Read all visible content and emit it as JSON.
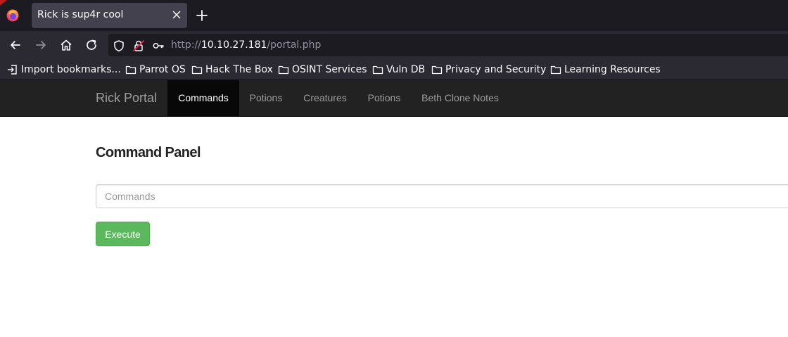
{
  "browser": {
    "tab": {
      "title": "Rick is sup4r cool"
    },
    "url": {
      "scheme": "http://",
      "host": "10.10.27.181",
      "path": "/portal.php"
    },
    "bookmarks": [
      {
        "label": "Import bookmarks...",
        "icon": "import-icon"
      },
      {
        "label": "Parrot OS",
        "icon": "folder-icon"
      },
      {
        "label": "Hack The Box",
        "icon": "folder-icon"
      },
      {
        "label": "OSINT Services",
        "icon": "folder-icon"
      },
      {
        "label": "Vuln DB",
        "icon": "folder-icon"
      },
      {
        "label": "Privacy and Security",
        "icon": "folder-icon"
      },
      {
        "label": "Learning Resources",
        "icon": "folder-icon"
      }
    ]
  },
  "site": {
    "brand": "Rick Portal",
    "menu": [
      {
        "label": "Commands",
        "active": true
      },
      {
        "label": "Potions",
        "active": false
      },
      {
        "label": "Creatures",
        "active": false
      },
      {
        "label": "Potions",
        "active": false
      },
      {
        "label": "Beth Clone Notes",
        "active": false
      }
    ]
  },
  "main": {
    "title": "Command Panel",
    "command_input": {
      "placeholder": "Commands",
      "value": ""
    },
    "execute_label": "Execute"
  },
  "colors": {
    "nav_background": "#222222",
    "nav_active": "#080808",
    "button_success": "#5cb85c"
  }
}
